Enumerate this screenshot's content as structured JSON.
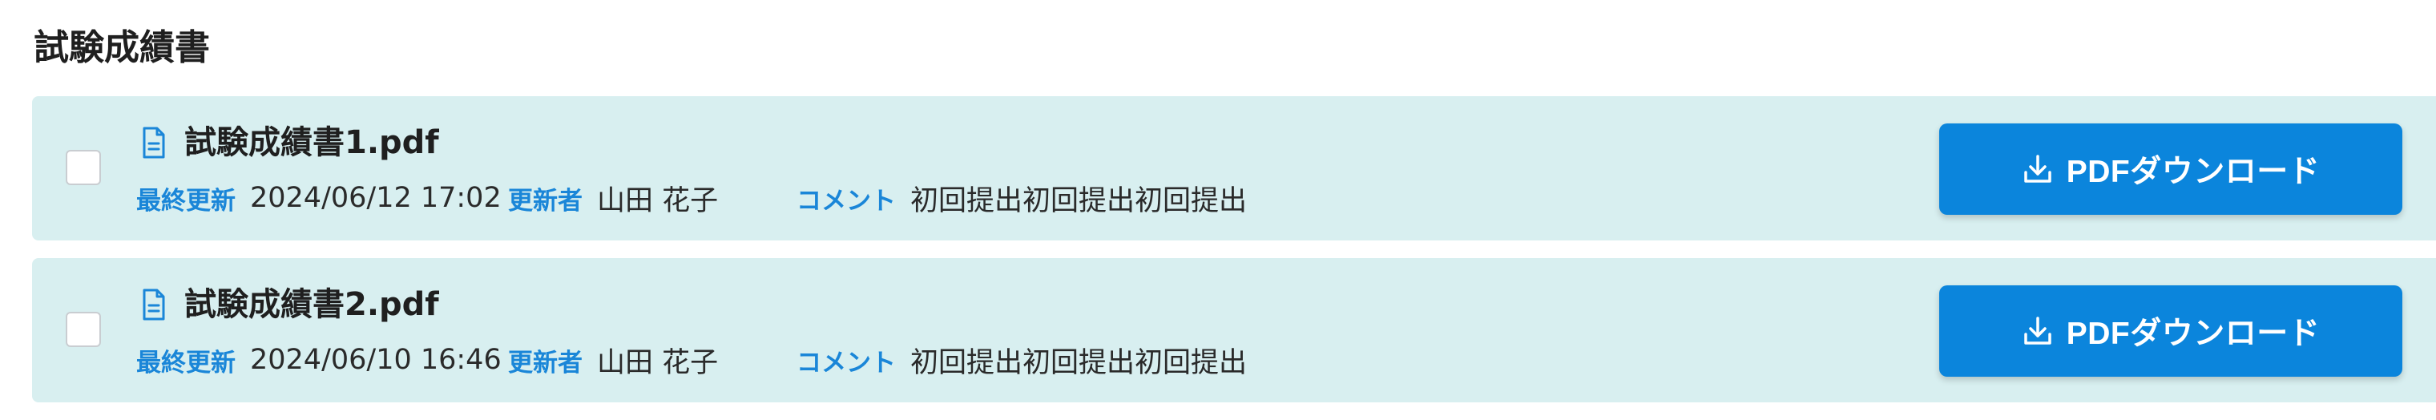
{
  "section": {
    "title": "試験成績書"
  },
  "labels": {
    "updated": "最終更新",
    "updater": "更新者",
    "comment": "コメント",
    "download_button": "PDFダウンロード"
  },
  "files": [
    {
      "name": "試験成績書1.pdf",
      "updated": "2024/06/12 17:02",
      "updater": "山田 花子",
      "comment": "初回提出初回提出初回提出",
      "checked": false
    },
    {
      "name": "試験成績書2.pdf",
      "updated": "2024/06/10 16:46",
      "updater": "山田 花子",
      "comment": "初回提出初回提出初回提出",
      "checked": false
    }
  ],
  "colors": {
    "accent": "#0b85dc",
    "label": "#1a86d8",
    "card_background": "#d8eff0"
  },
  "icons": {
    "file": "document-icon",
    "download": "download-icon"
  }
}
